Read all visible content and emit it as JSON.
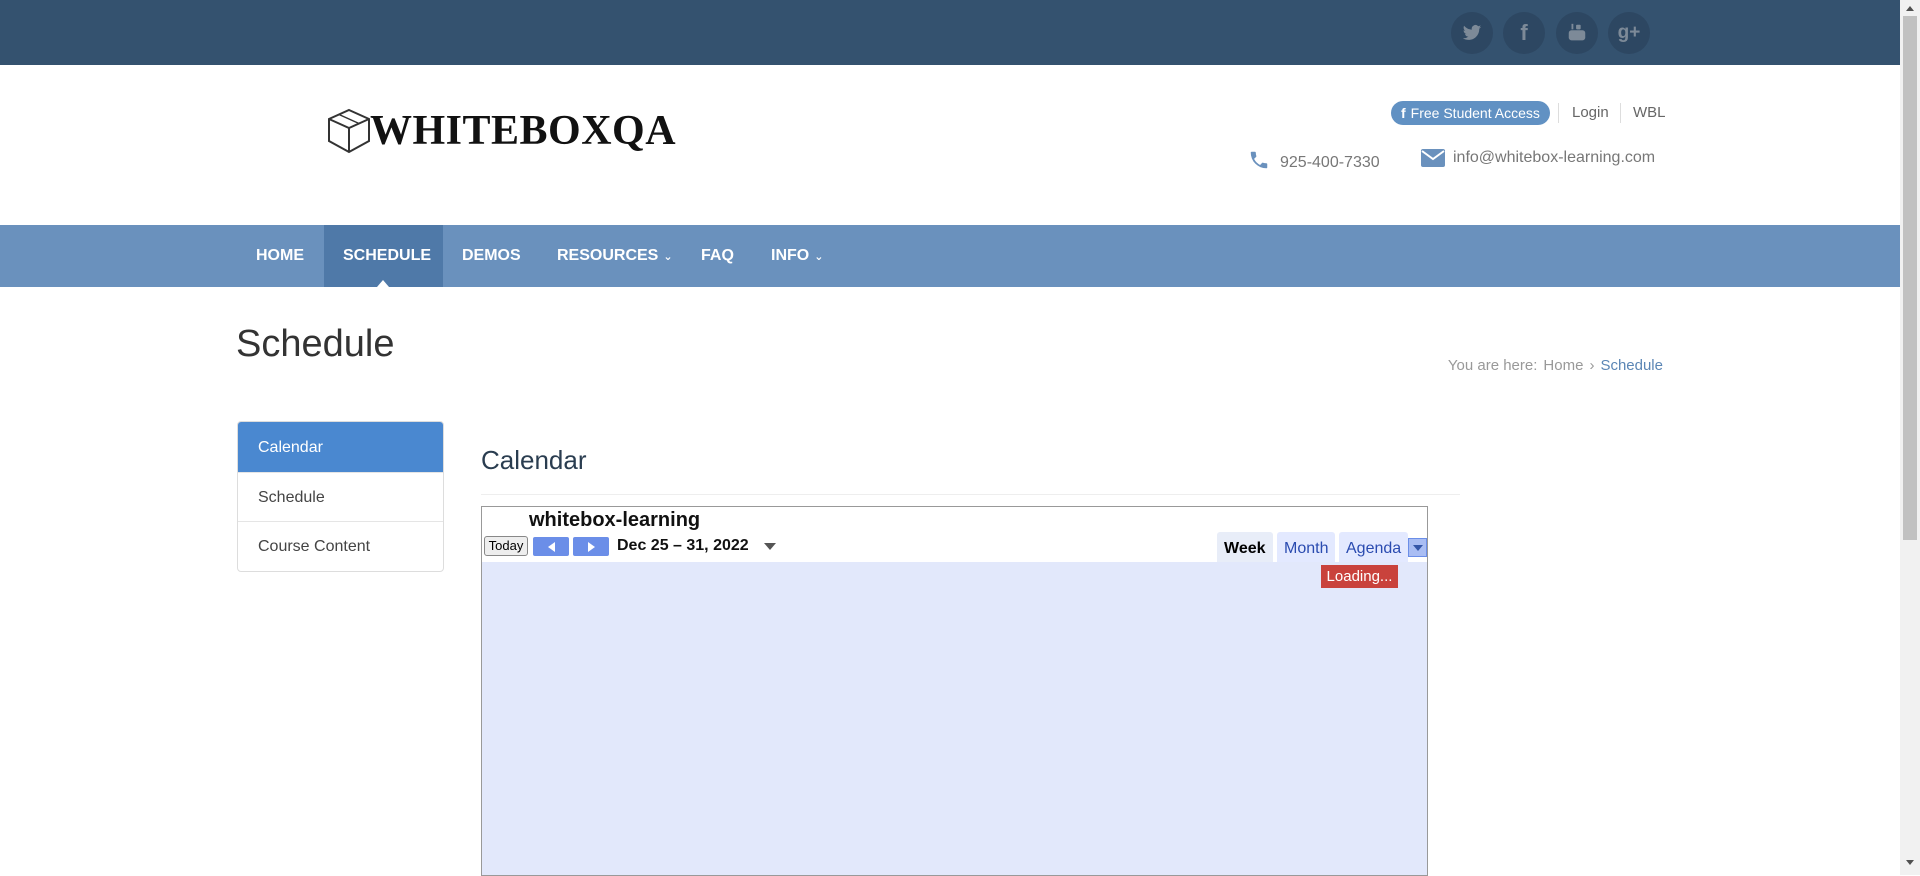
{
  "social": {
    "twitter": "t",
    "facebook": "f",
    "youtube": "▶",
    "googleplus": "g+"
  },
  "logo": {
    "text": "WHITEBOXQA"
  },
  "header": {
    "free_student_access": "Free Student Access",
    "login": "Login",
    "wbl": "WBL",
    "phone": "925-400-7330",
    "email": "info@whitebox-learning.com"
  },
  "nav": {
    "home": "HOME",
    "schedule": "SCHEDULE",
    "demos": "DEMOS",
    "resources": "RESOURCES",
    "faq": "FAQ",
    "info": "INFO"
  },
  "page": {
    "title": "Schedule"
  },
  "breadcrumb": {
    "prefix": "You are here:",
    "home": "Home",
    "current": "Schedule"
  },
  "sidebar": {
    "items": [
      {
        "label": "Calendar"
      },
      {
        "label": "Schedule"
      },
      {
        "label": "Course Content"
      }
    ]
  },
  "main": {
    "title": "Calendar",
    "calendar": {
      "name": "whitebox-learning",
      "today_label": "Today",
      "date_range": "Dec 25 – 31, 2022",
      "views": {
        "week": "Week",
        "month": "Month",
        "agenda": "Agenda"
      },
      "loading": "Loading..."
    }
  },
  "colors": {
    "topbar": "#34526f",
    "nav": "#6a91bd",
    "nav_active": "#4f79a8",
    "sidebar_active": "#4a88d0",
    "calendar_bg": "#e2e8fb",
    "loading": "#c9423c"
  }
}
